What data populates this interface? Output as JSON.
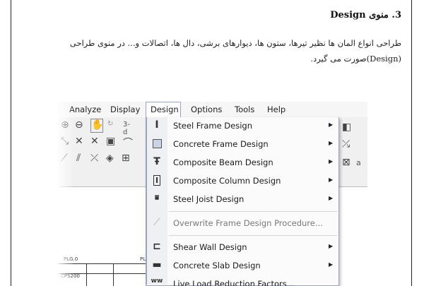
{
  "document": {
    "heading": "3.  منوی Design",
    "paragraph_line1": "طراحی انواع المان ها نظیر تیرها، ستون ها، دیوارهای برشی، دال ها، اتصالات و... در منوی طراحی",
    "paragraph_line2": "(Design)صورت می گیرد."
  },
  "menubar": {
    "items": [
      "Analyze",
      "Display",
      "Design",
      "Options",
      "Tools",
      "Help"
    ]
  },
  "toolbar": {
    "view_label": "3-d",
    "right_label": "a"
  },
  "design_menu": {
    "items": [
      {
        "label": "Steel Frame Design",
        "icon": "steel-frame-icon",
        "submenu": true,
        "enabled": true
      },
      {
        "label": "Concrete Frame Design",
        "icon": "concrete-frame-icon",
        "submenu": true,
        "enabled": true
      },
      {
        "label": "Composite Beam Design",
        "icon": "composite-beam-icon",
        "submenu": true,
        "enabled": true
      },
      {
        "label": "Composite Column Design",
        "icon": "composite-column-icon",
        "submenu": true,
        "enabled": true
      },
      {
        "label": "Steel Joist Design",
        "icon": "steel-joist-icon",
        "submenu": true,
        "enabled": true
      },
      {
        "label": "Overwrite Frame Design Procedure...",
        "icon": "overwrite-icon",
        "submenu": false,
        "enabled": false
      },
      {
        "label": "Shear Wall Design",
        "icon": "shear-wall-icon",
        "submenu": true,
        "enabled": true
      },
      {
        "label": "Concrete Slab Design",
        "icon": "concrete-slab-icon",
        "submenu": true,
        "enabled": true
      },
      {
        "label": "Live Load Reduction Factors...",
        "icon": "live-load-icon",
        "submenu": false,
        "enabled": true
      }
    ]
  },
  "canvas": {
    "labels": [
      "PLG.0",
      "CPS200",
      "PL"
    ]
  }
}
